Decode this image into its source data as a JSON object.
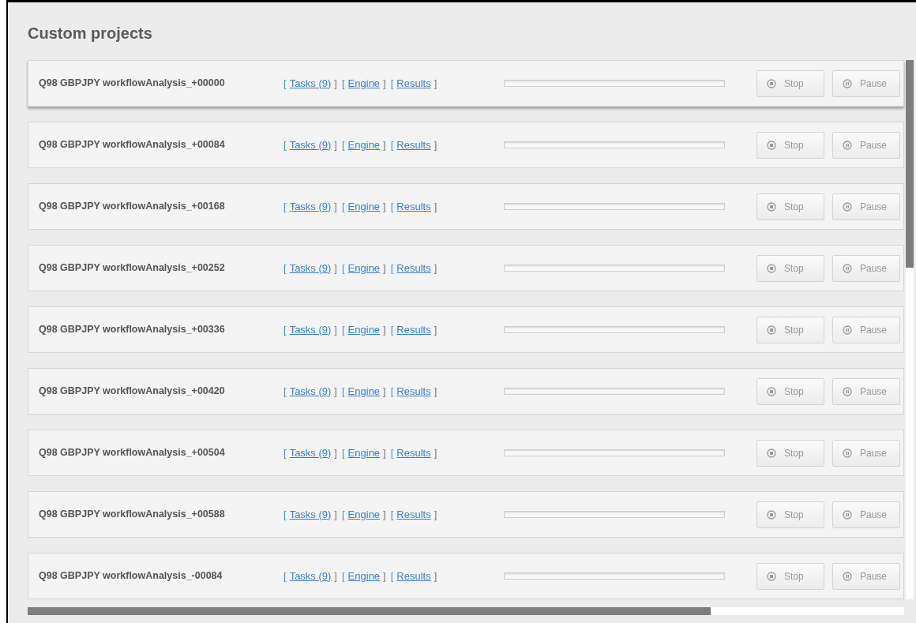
{
  "title": "Custom projects",
  "bracket_open": "[",
  "bracket_close": "]",
  "projects": [
    {
      "name": "Q98 GBPJPY workflowAnalysis_+00000",
      "links": [
        "Tasks (9)",
        "Engine",
        "Results"
      ],
      "level": 0,
      "buttons": [
        "Stop",
        "Pause"
      ]
    },
    {
      "name": "Q98 GBPJPY workflowAnalysis_+00084",
      "links": [
        "Tasks (9)",
        "Engine",
        "Results"
      ],
      "level": 0,
      "buttons": [
        "Stop",
        "Pause"
      ]
    },
    {
      "name": "Q98 GBPJPY workflowAnalysis_+00168",
      "links": [
        "Tasks (9)",
        "Engine",
        "Results"
      ],
      "level": 0,
      "buttons": [
        "Stop",
        "Pause"
      ]
    },
    {
      "name": "Q98 GBPJPY workflowAnalysis_+00252",
      "links": [
        "Tasks (9)",
        "Engine",
        "Results"
      ],
      "level": 0,
      "buttons": [
        "Stop",
        "Pause"
      ]
    },
    {
      "name": "Q98 GBPJPY workflowAnalysis_+00336",
      "links": [
        "Tasks (9)",
        "Engine",
        "Results"
      ],
      "level": 0,
      "buttons": [
        "Stop",
        "Pause"
      ]
    },
    {
      "name": "Q98 GBPJPY workflowAnalysis_+00420",
      "links": [
        "Tasks (9)",
        "Engine",
        "Results"
      ],
      "level": 0,
      "buttons": [
        "Stop",
        "Pause"
      ]
    },
    {
      "name": "Q98 GBPJPY workflowAnalysis_+00504",
      "links": [
        "Tasks (9)",
        "Engine",
        "Results"
      ],
      "level": 0,
      "buttons": [
        "Stop",
        "Pause"
      ]
    },
    {
      "name": "Q98 GBPJPY workflowAnalysis_+00588",
      "links": [
        "Tasks (9)",
        "Engine",
        "Results"
      ],
      "level": 0,
      "buttons": [
        "Stop",
        "Pause"
      ]
    },
    {
      "name": "Q98 GBPJPY workflowAnalysis_-00084",
      "links": [
        "Tasks (9)",
        "Engine",
        "Results"
      ],
      "level": 0,
      "buttons": [
        "Stop",
        "Pause"
      ]
    }
  ]
}
